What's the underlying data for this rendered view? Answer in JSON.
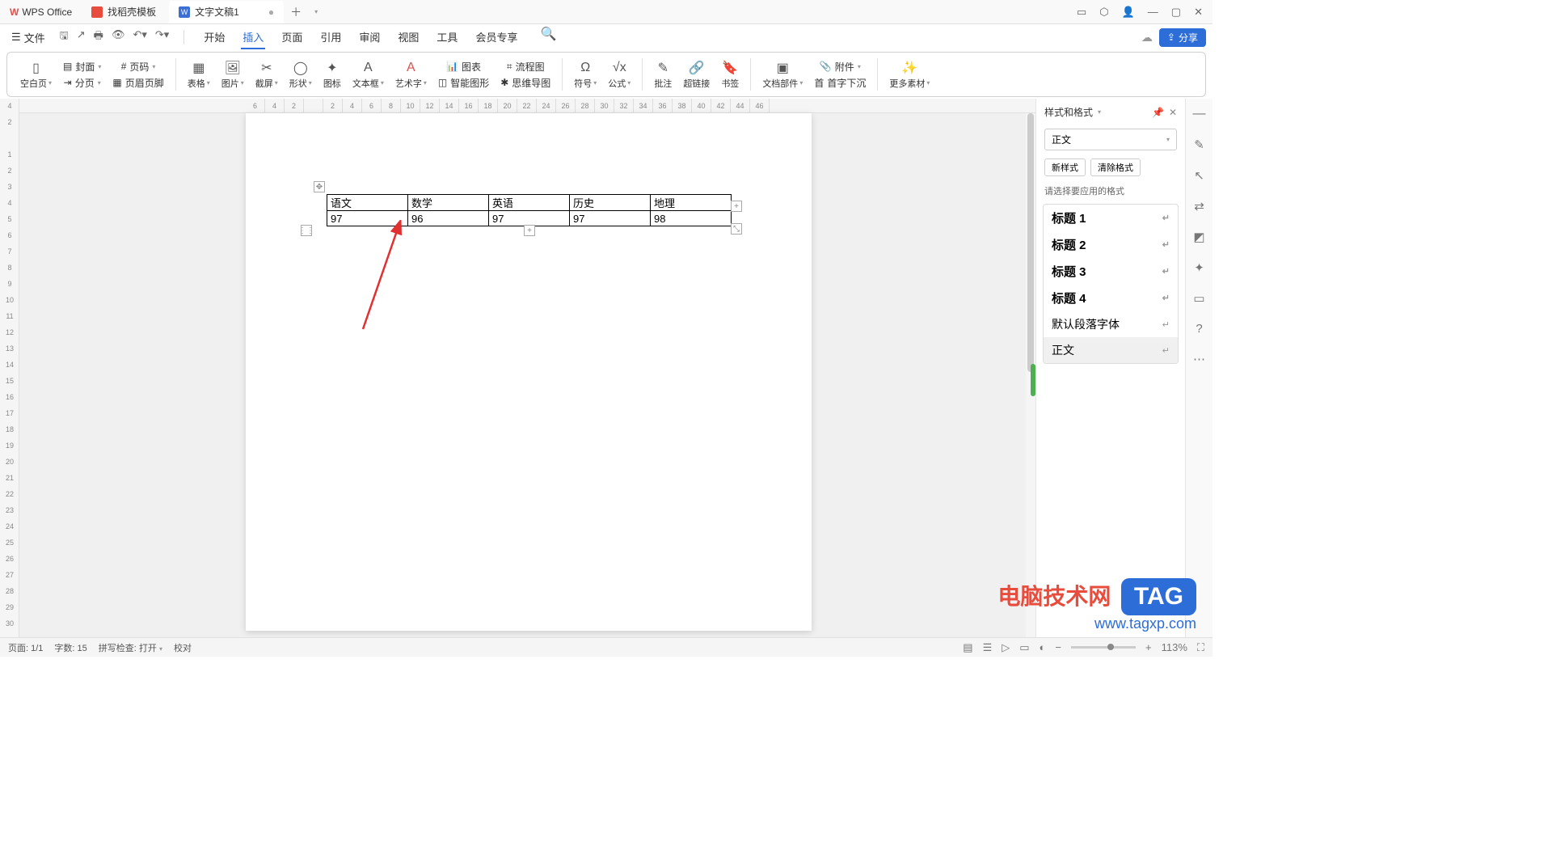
{
  "app": {
    "name": "WPS Office"
  },
  "tabs": [
    {
      "label": "找稻壳模板"
    },
    {
      "label": "文字文稿1"
    }
  ],
  "menu": {
    "file": "文件",
    "items": [
      "开始",
      "插入",
      "页面",
      "引用",
      "审阅",
      "视图",
      "工具",
      "会员专享"
    ],
    "share": "分享"
  },
  "ribbon": {
    "blank_page": "空白页",
    "cover": "封面",
    "page_num": "页码",
    "page_break": "分页",
    "header_footer": "页眉页脚",
    "table": "表格",
    "picture": "图片",
    "screenshot": "截屏",
    "shape": "形状",
    "icon": "图标",
    "textbox": "文本框",
    "wordart": "艺术字",
    "chart": "图表",
    "flowchart": "流程图",
    "smartart": "智能图形",
    "mindmap": "思维导图",
    "symbol": "符号",
    "formula": "公式",
    "comment": "批注",
    "hyperlink": "超链接",
    "bookmark": "书签",
    "parts": "文档部件",
    "dropcap": "首字下沉",
    "attachment": "附件",
    "more": "更多素材"
  },
  "ruler_h": [
    "6",
    "4",
    "2",
    "",
    "2",
    "4",
    "6",
    "8",
    "10",
    "12",
    "14",
    "16",
    "18",
    "20",
    "22",
    "24",
    "26",
    "28",
    "30",
    "32",
    "34",
    "36",
    "38",
    "40",
    "42",
    "44",
    "46"
  ],
  "ruler_v": [
    "4",
    "2",
    "",
    "1",
    "2",
    "3",
    "4",
    "5",
    "6",
    "7",
    "8",
    "9",
    "10",
    "11",
    "12",
    "13",
    "14",
    "15",
    "16",
    "17",
    "18",
    "19",
    "20",
    "21",
    "22",
    "23",
    "24",
    "25",
    "26",
    "27",
    "28",
    "29",
    "30"
  ],
  "table": {
    "headers": [
      "语文",
      "数学",
      "英语",
      "历史",
      "地理"
    ],
    "values": [
      "97",
      "96",
      "97",
      "97",
      "98"
    ]
  },
  "panel": {
    "title": "样式和格式",
    "current": "正文",
    "new_style": "新样式",
    "clear": "清除格式",
    "hint": "请选择要应用的格式",
    "items": [
      {
        "label": "标题 1",
        "heading": true
      },
      {
        "label": "标题 2",
        "heading": true
      },
      {
        "label": "标题 3",
        "heading": true
      },
      {
        "label": "标题 4",
        "heading": true
      },
      {
        "label": "默认段落字体",
        "heading": false
      },
      {
        "label": "正文",
        "heading": false,
        "selected": true
      }
    ]
  },
  "status": {
    "page": "页面: 1/1",
    "words": "字数: 15",
    "spell": "拼写检查: 打开",
    "proof": "校对",
    "zoom": "113%"
  },
  "watermark": {
    "title": "电脑技术网",
    "tag": "TAG",
    "url": "www.tagxp.com"
  }
}
